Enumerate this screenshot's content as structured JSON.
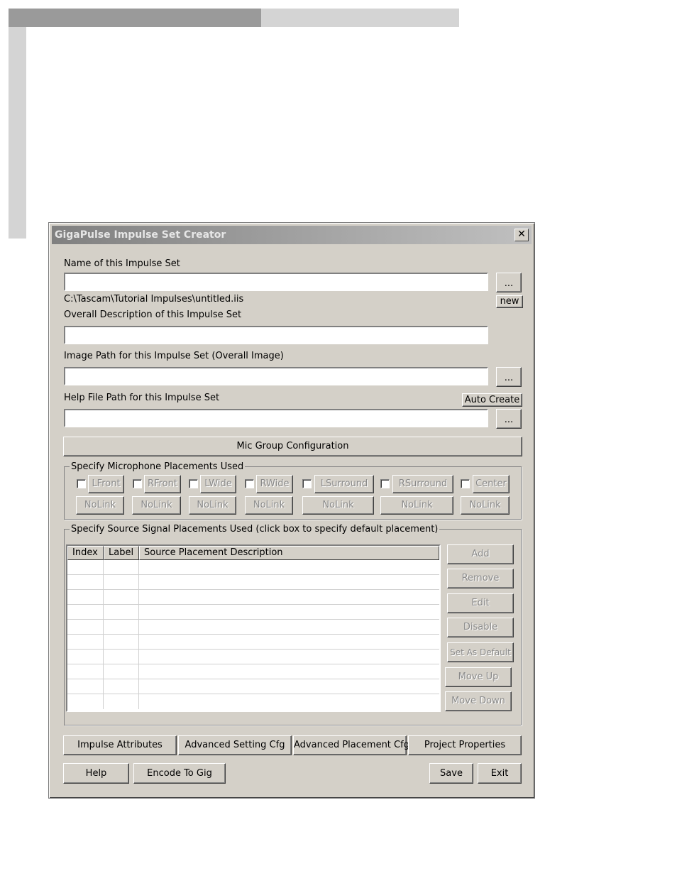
{
  "window": {
    "title": "GigaPulse Impulse Set Creator",
    "close_glyph": "✕"
  },
  "name_section": {
    "label": "Name of this Impulse Set",
    "value": "",
    "browse_label": "...",
    "new_label": "new",
    "path": "C:\\Tascam\\Tutorial Impulses\\untitled.iis"
  },
  "description_section": {
    "label": "Overall Description of this Impulse Set",
    "value": ""
  },
  "image_section": {
    "label": "Image Path for this Impulse Set (Overall Image)",
    "value": "",
    "browse_label": "..."
  },
  "help_section": {
    "label": "Help File Path for this Impulse Set",
    "value": "",
    "auto_create_label": "Auto Create",
    "browse_label": "..."
  },
  "mic_group_button": "Mic Group Configuration",
  "mic_placements": {
    "title": "Specify Microphone Placements Used",
    "items": [
      {
        "label": "LFront",
        "link": "NoLink"
      },
      {
        "label": "RFront",
        "link": "NoLink"
      },
      {
        "label": "LWide",
        "link": "NoLink"
      },
      {
        "label": "RWide",
        "link": "NoLink"
      },
      {
        "label": "LSurround",
        "link": "NoLink"
      },
      {
        "label": "RSurround",
        "link": "NoLink"
      },
      {
        "label": "Center",
        "link": "NoLink"
      }
    ]
  },
  "source_placements": {
    "title": "Specify Source Signal Placements Used (click box to specify default placement)",
    "columns": [
      "Index",
      "Label",
      "Source Placement Description"
    ],
    "buttons": [
      "Add",
      "Remove",
      "Edit",
      "Disable",
      "Set As Default",
      "Move Up",
      "Move Down"
    ]
  },
  "bottom_row1": [
    "Impulse Attributes",
    "Advanced Setting Cfg",
    "Advanced Placement Cfg",
    "Project Properties"
  ],
  "bottom_row2": {
    "help": "Help",
    "encode": "Encode To Gig",
    "save": "Save",
    "exit": "Exit"
  }
}
